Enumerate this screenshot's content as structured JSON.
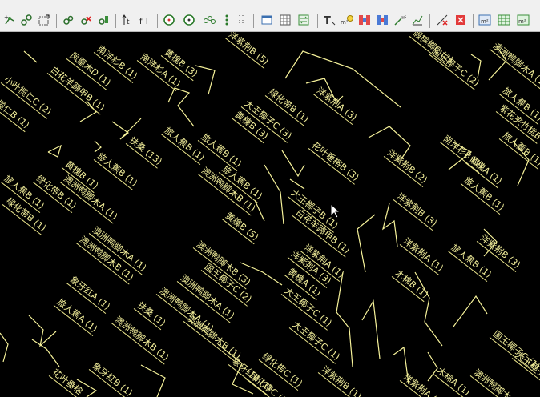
{
  "toolbar": {
    "buttons": [
      {
        "name": "tree-add-icon"
      },
      {
        "name": "tree-link-icon"
      },
      {
        "name": "select-area-icon"
      },
      {
        "name": "tree-move-icon"
      },
      {
        "name": "tree-delete-icon"
      },
      {
        "name": "tree-edit-icon"
      },
      {
        "name": "height-up-icon"
      },
      {
        "name": "text-height-icon"
      },
      {
        "name": "circle-icon"
      },
      {
        "name": "target-icon"
      },
      {
        "name": "node-chain-icon"
      },
      {
        "name": "column-dots-icon"
      },
      {
        "name": "window-icon"
      },
      {
        "name": "grid-icon"
      },
      {
        "name": "swap-icon"
      },
      {
        "name": "text-t-icon"
      },
      {
        "name": "m2-bulb-icon"
      },
      {
        "name": "bars-red-icon"
      },
      {
        "name": "bars-blue-icon"
      },
      {
        "name": "m2-slope-icon"
      },
      {
        "name": "area-chart-icon"
      },
      {
        "name": "crosshair-icon"
      },
      {
        "name": "stop-red-icon"
      },
      {
        "name": "m2-box-icon"
      },
      {
        "name": "green-grid-icon"
      },
      {
        "name": "m2-green-icon"
      }
    ]
  },
  "labels": [
    {
      "text": "南洋杉B (1)"
    },
    {
      "text": "南洋杉A (1)"
    },
    {
      "text": "黄槐B (3)"
    },
    {
      "text": "洋紫荆B (5)"
    },
    {
      "text": "假槟榔C (2)"
    },
    {
      "text": "凤凰木D (1)"
    },
    {
      "text": "白花羊蹄甲B (1)"
    },
    {
      "text": "小叶榄仁C (2)"
    },
    {
      "text": "榄仁B (1)"
    },
    {
      "text": "大王椰子C (3)"
    },
    {
      "text": "绿化带B (1)"
    },
    {
      "text": "黄槐B (3)"
    },
    {
      "text": "洋紫荆A (3)"
    },
    {
      "text": "澳洲鸭脚木A (1)"
    },
    {
      "text": "旅人蕉B (1)"
    },
    {
      "text": "紫花夹竹桃B"
    },
    {
      "text": "旅人蕉B (1)"
    },
    {
      "text": "旅人蕉B (1)"
    },
    {
      "text": "扶桑 (13)"
    },
    {
      "text": "花叶垂榕B (3)"
    },
    {
      "text": "洋紫荆B (2)"
    },
    {
      "text": "南洋杉B (1)"
    },
    {
      "text": "旅人蕉B (1)"
    },
    {
      "text": "旅人蕉B (1)"
    },
    {
      "text": "旅人蕉B (1)"
    },
    {
      "text": "澳洲鸭脚木B (1)"
    },
    {
      "text": "旅人蕉B (1)"
    },
    {
      "text": "黄槐A (1)"
    },
    {
      "text": "黄槐B (1)"
    },
    {
      "text": "澳洲鸭脚木A (1)"
    },
    {
      "text": "大王椰子B (1)"
    },
    {
      "text": "洋紫荆B (3)"
    },
    {
      "text": "旅人蕉B (1)"
    },
    {
      "text": "绿化带B (1)"
    },
    {
      "text": "黄槐B (5)"
    },
    {
      "text": "白花羊蹄甲B (1)"
    },
    {
      "text": "澳洲鸭脚木A (1)"
    },
    {
      "text": "澳洲鸭脚木B (1)"
    },
    {
      "text": "洋紫荆A (1)"
    },
    {
      "text": "洋紫荆A (1)"
    },
    {
      "text": "洋紫荆B (3)"
    },
    {
      "text": "旅人蕉B (1)"
    },
    {
      "text": "国王椰子C (2)"
    },
    {
      "text": "黄槐A (1)"
    },
    {
      "text": "澳洲鸭脚木A (1)"
    },
    {
      "text": "木棉B (1)"
    },
    {
      "text": "洋紫荆A (3)"
    },
    {
      "text": "象牙红A (1)"
    },
    {
      "text": "澳洲鸭脚木A (1)"
    },
    {
      "text": "大王椰子C (1)"
    },
    {
      "text": "旅人蕉A (1)"
    },
    {
      "text": "扶桑 (1)"
    },
    {
      "text": "澳洲鸭脚木B (1)"
    },
    {
      "text": "大王椰子C (1)"
    },
    {
      "text": "绿化带C (1)"
    },
    {
      "text": "象牙红B (1)"
    },
    {
      "text": "象牙红B (1)"
    },
    {
      "text": "绿化带C (1)"
    },
    {
      "text": "洋紫荆B (1)"
    },
    {
      "text": "花叶垂榕"
    },
    {
      "text": "洋紫荆A (1)"
    },
    {
      "text": "木棉A (1)"
    },
    {
      "text": "澳洲鸭脚木"
    },
    {
      "text": "国王椰子C (1)"
    },
    {
      "text": "国王椰子C (2)"
    },
    {
      "text": "澳洲鸭脚木B (3)"
    },
    {
      "text": "澳洲鸭脚木B (1)"
    },
    {
      "text": "绿化带B (1)"
    },
    {
      "text": "大王椰子"
    }
  ]
}
